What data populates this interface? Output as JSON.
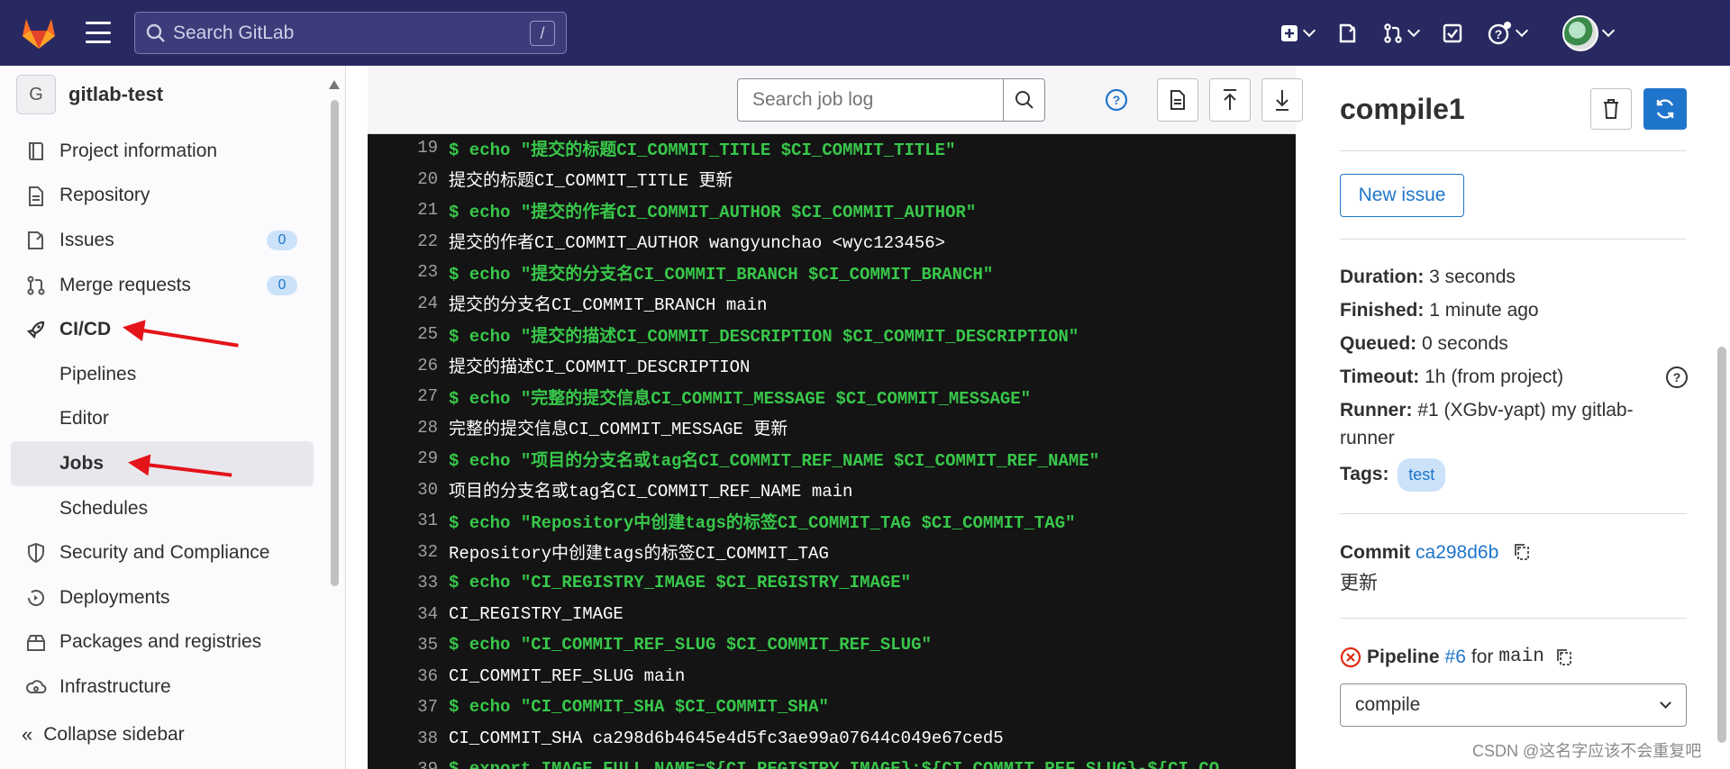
{
  "topbar": {
    "search_placeholder": "Search GitLab",
    "search_shortcut": "/"
  },
  "sidebar": {
    "project_initial": "G",
    "project_name": "gitlab-test",
    "items": [
      {
        "label": "Project information",
        "icon": "book-icon"
      },
      {
        "label": "Repository",
        "icon": "document-icon"
      },
      {
        "label": "Issues",
        "icon": "issues-icon",
        "badge": "0"
      },
      {
        "label": "Merge requests",
        "icon": "merge-request-icon",
        "badge": "0"
      },
      {
        "label": "CI/CD",
        "icon": "rocket-icon"
      },
      {
        "label": "Pipelines"
      },
      {
        "label": "Editor"
      },
      {
        "label": "Jobs"
      },
      {
        "label": "Schedules"
      },
      {
        "label": "Security and Compliance",
        "icon": "shield-icon"
      },
      {
        "label": "Deployments",
        "icon": "deployments-icon"
      },
      {
        "label": "Packages and registries",
        "icon": "package-icon"
      },
      {
        "label": "Infrastructure",
        "icon": "cloud-gear-icon"
      }
    ],
    "collapse_label": "Collapse sidebar"
  },
  "log_toolbar": {
    "search_placeholder": "Search job log"
  },
  "log": {
    "lines": [
      {
        "n": "19",
        "type": "cmd",
        "text": "$ echo \"提交的标题CI_COMMIT_TITLE $CI_COMMIT_TITLE\""
      },
      {
        "n": "20",
        "type": "out",
        "text": "提交的标题CI_COMMIT_TITLE 更新"
      },
      {
        "n": "21",
        "type": "cmd",
        "text": "$ echo \"提交的作者CI_COMMIT_AUTHOR  $CI_COMMIT_AUTHOR\""
      },
      {
        "n": "22",
        "type": "out",
        "text": "提交的作者CI_COMMIT_AUTHOR  wangyunchao <wyc123456>"
      },
      {
        "n": "23",
        "type": "cmd",
        "text": "$ echo \"提交的分支名CI_COMMIT_BRANCH $CI_COMMIT_BRANCH\""
      },
      {
        "n": "24",
        "type": "out",
        "text": "提交的分支名CI_COMMIT_BRANCH main"
      },
      {
        "n": "25",
        "type": "cmd",
        "text": "$ echo \"提交的描述CI_COMMIT_DESCRIPTION $CI_COMMIT_DESCRIPTION\""
      },
      {
        "n": "26",
        "type": "out",
        "text": "提交的描述CI_COMMIT_DESCRIPTION"
      },
      {
        "n": "27",
        "type": "cmd",
        "text": "$ echo \"完整的提交信息CI_COMMIT_MESSAGE $CI_COMMIT_MESSAGE\""
      },
      {
        "n": "28",
        "type": "out",
        "text": "完整的提交信息CI_COMMIT_MESSAGE 更新"
      },
      {
        "n": "29",
        "type": "cmd",
        "text": "$ echo \"项目的分支名或tag名CI_COMMIT_REF_NAME $CI_COMMIT_REF_NAME\""
      },
      {
        "n": "30",
        "type": "out",
        "text": "项目的分支名或tag名CI_COMMIT_REF_NAME main"
      },
      {
        "n": "31",
        "type": "cmd",
        "text": "$ echo \"Repository中创建tags的标签CI_COMMIT_TAG $CI_COMMIT_TAG\""
      },
      {
        "n": "32",
        "type": "out",
        "text": "Repository中创建tags的标签CI_COMMIT_TAG"
      },
      {
        "n": "33",
        "type": "cmd",
        "text": "$ echo \"CI_REGISTRY_IMAGE $CI_REGISTRY_IMAGE\""
      },
      {
        "n": "34",
        "type": "out",
        "text": "CI_REGISTRY_IMAGE"
      },
      {
        "n": "35",
        "type": "cmd",
        "text": "$ echo \"CI_COMMIT_REF_SLUG $CI_COMMIT_REF_SLUG\""
      },
      {
        "n": "36",
        "type": "out",
        "text": "CI_COMMIT_REF_SLUG main"
      },
      {
        "n": "37",
        "type": "cmd",
        "text": "$ echo \"CI_COMMIT_SHA $CI_COMMIT_SHA\""
      },
      {
        "n": "38",
        "type": "out",
        "text": "CI_COMMIT_SHA ca298d6b4645e4d5fc3ae99a07644c049e67ced5"
      },
      {
        "n": "39",
        "type": "cmd",
        "text": "$ export IMAGE_FULL_NAME=${CI_REGISTRY_IMAGE}:${CI_COMMIT_REF_SLUG}-${CI_CO"
      }
    ]
  },
  "job": {
    "title": "compile1",
    "new_issue_label": "New issue",
    "duration_label": "Duration:",
    "duration_value": "3 seconds",
    "finished_label": "Finished:",
    "finished_value": "1 minute ago",
    "queued_label": "Queued:",
    "queued_value": "0 seconds",
    "timeout_label": "Timeout:",
    "timeout_value": "1h (from project)",
    "runner_label": "Runner:",
    "runner_value_1": "#1 (XGbv-yapt) my gitlab-",
    "runner_value_2": "runner",
    "tags_label": "Tags:",
    "tag": "test",
    "commit_label": "Commit",
    "commit_sha": "ca298d6b",
    "commit_message": "更新",
    "pipeline_label": "Pipeline",
    "pipeline_id": "#6",
    "pipeline_for": "for",
    "pipeline_branch": "main",
    "stage_select": "compile"
  },
  "watermark": "CSDN @这名字应该不会重复吧",
  "colors": {
    "topbar": "#292961",
    "link": "#1f75cb",
    "log_bg": "#141414",
    "cmd_green": "#38c74a",
    "arrow_red": "#e3141a",
    "failed_red": "#dd2b0e"
  }
}
